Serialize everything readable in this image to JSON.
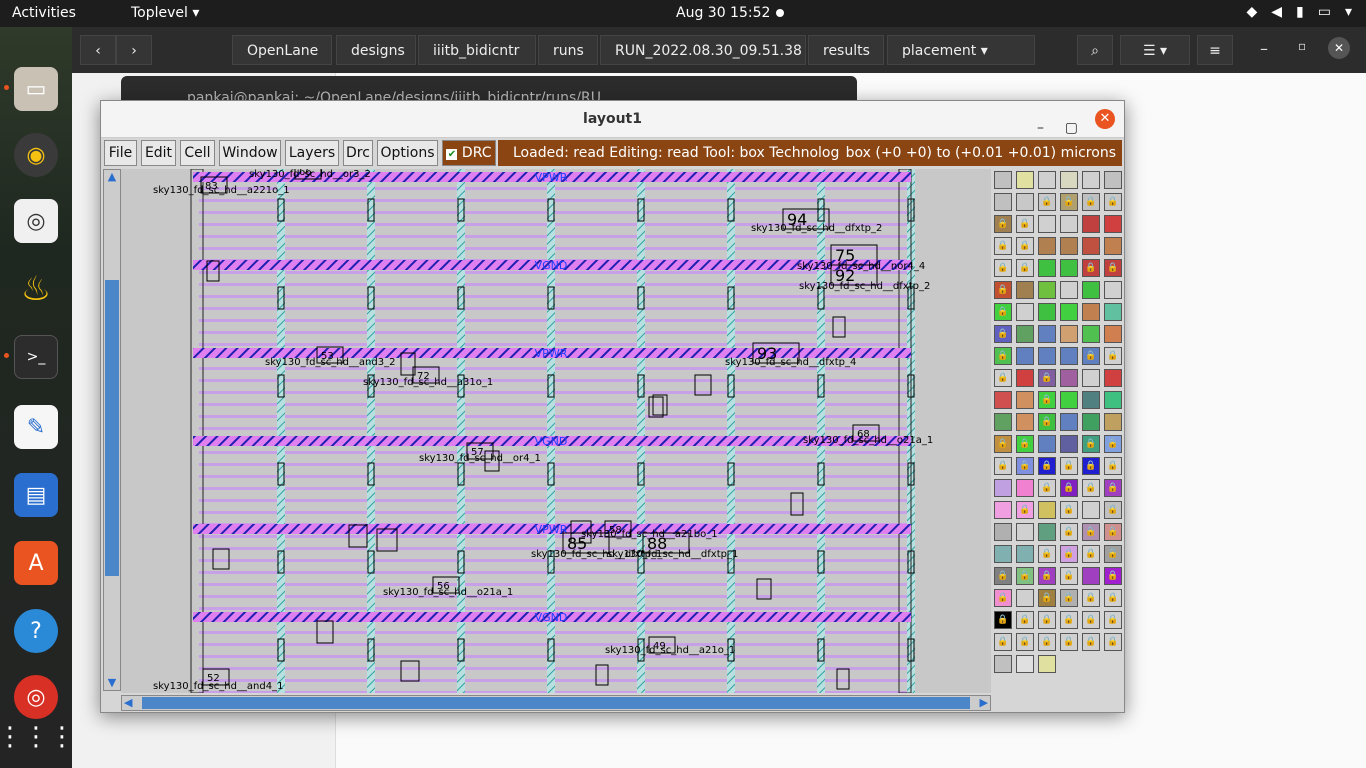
{
  "topbar": {
    "activities": "Activities",
    "app_menu": "Toplevel",
    "clock": "Aug 30  15:52"
  },
  "files": {
    "path": [
      "OpenLane",
      "designs",
      "iiitb_bidicntr",
      "runs",
      "RUN_2022.08.30_09.51.38",
      "results",
      "placement"
    ]
  },
  "terminal": {
    "title": "pankaj@pankaj: ~/OpenLane/designs/iiitb_bidicntr/runs/RU"
  },
  "magic": {
    "title": "layout1",
    "menu": [
      "File",
      "Edit",
      "Cell",
      "Window",
      "Layers",
      "Drc",
      "Options"
    ],
    "drc_label": "DRC",
    "status_left": "Loaded: read  Editing: read  Tool: box   Technology: sk",
    "status_right": "box (+0 +0) to (+0.01 +0.01) microns",
    "rail_labels": [
      "VPWR",
      "VGND",
      "VPWR",
      "VGND",
      "VPWR",
      "VGND"
    ],
    "cell_labels": [
      {
        "name": "sky130_fd_sc_hd__a221o_1",
        "id": "83"
      },
      {
        "name": "sky130_fd_sc_hd__or3_2",
        "id": "66"
      },
      {
        "name": "sky130_fd_sc_hd__dfxtp_2",
        "id": "94"
      },
      {
        "name": "sky130_fd_sc_hd__nor4_4",
        "id": "75"
      },
      {
        "name": "sky130_fd_sc_hd__dfxtp_2",
        "id": "92"
      },
      {
        "name": "sky130_fd_sc_hd__and3_2",
        "id": "53"
      },
      {
        "name": "sky130_fd_sc_hd__a31o_1",
        "id": "72"
      },
      {
        "name": "sky130_fd_sc_hd__dfxtp_4",
        "id": "93"
      },
      {
        "name": "sky130_fd_sc_hd__or4_1",
        "id": "57"
      },
      {
        "name": "sky130_fd_sc_hd__o21a_1",
        "id": "68"
      },
      {
        "name": "sky130_fd_sc_hd__a21bo_1",
        "id": "58"
      },
      {
        "name": "sky130_fd_sc_hd__dfxtp_1",
        "id": "85"
      },
      {
        "name": "sky130_fd_sc_hd__dfxtp_1",
        "id": "88"
      },
      {
        "name": "sky130_fd_sc_hd__o21a_1",
        "id": "56"
      },
      {
        "name": "sky130_fd_sc_hd__a21o_1",
        "id": "49"
      },
      {
        "name": "sky130_fd_sc_hd__and4_1",
        "id": "52"
      }
    ]
  },
  "colors": {
    "status_bg": "#8b4513",
    "scroll_thumb": "#4a86c8",
    "accent": "#e95420"
  }
}
